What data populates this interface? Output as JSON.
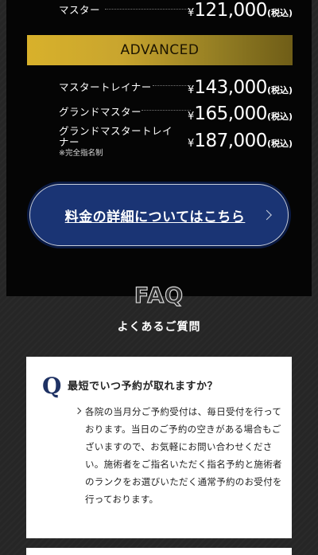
{
  "pricing": {
    "top_row": {
      "label": "マスター",
      "yen": "¥",
      "price": "121,000",
      "tax": "(税込)"
    },
    "advanced_label": "ADVANCED",
    "advanced_rows": [
      {
        "label": "マスタートレイナー",
        "yen": "¥",
        "price": "143,000",
        "tax": "(税込)"
      },
      {
        "label": "グランドマスター",
        "yen": "¥",
        "price": "165,000",
        "tax": "(税込)"
      },
      {
        "label": "グランドマスタートレイナー",
        "yen": "¥",
        "price": "187,000",
        "tax": "(税込)"
      }
    ],
    "note": "※完全指名制",
    "cta_label": "料金の詳細についてはこちら"
  },
  "faq": {
    "title": "FAQ",
    "subtitle": "よくあるご質問",
    "items": [
      {
        "q_mark": "Q",
        "question": "最短でいつ予約が取れますか？",
        "answer": "各院の当月分ご予約受付は、毎日受付を行っております。当日のご予約の空きがある場合もございますので、お気軽にお問い合わせください。施術者をご指名いただく指名予約と施術者のランクをお選びいただく通常予約のお受付を行っております。"
      }
    ]
  }
}
